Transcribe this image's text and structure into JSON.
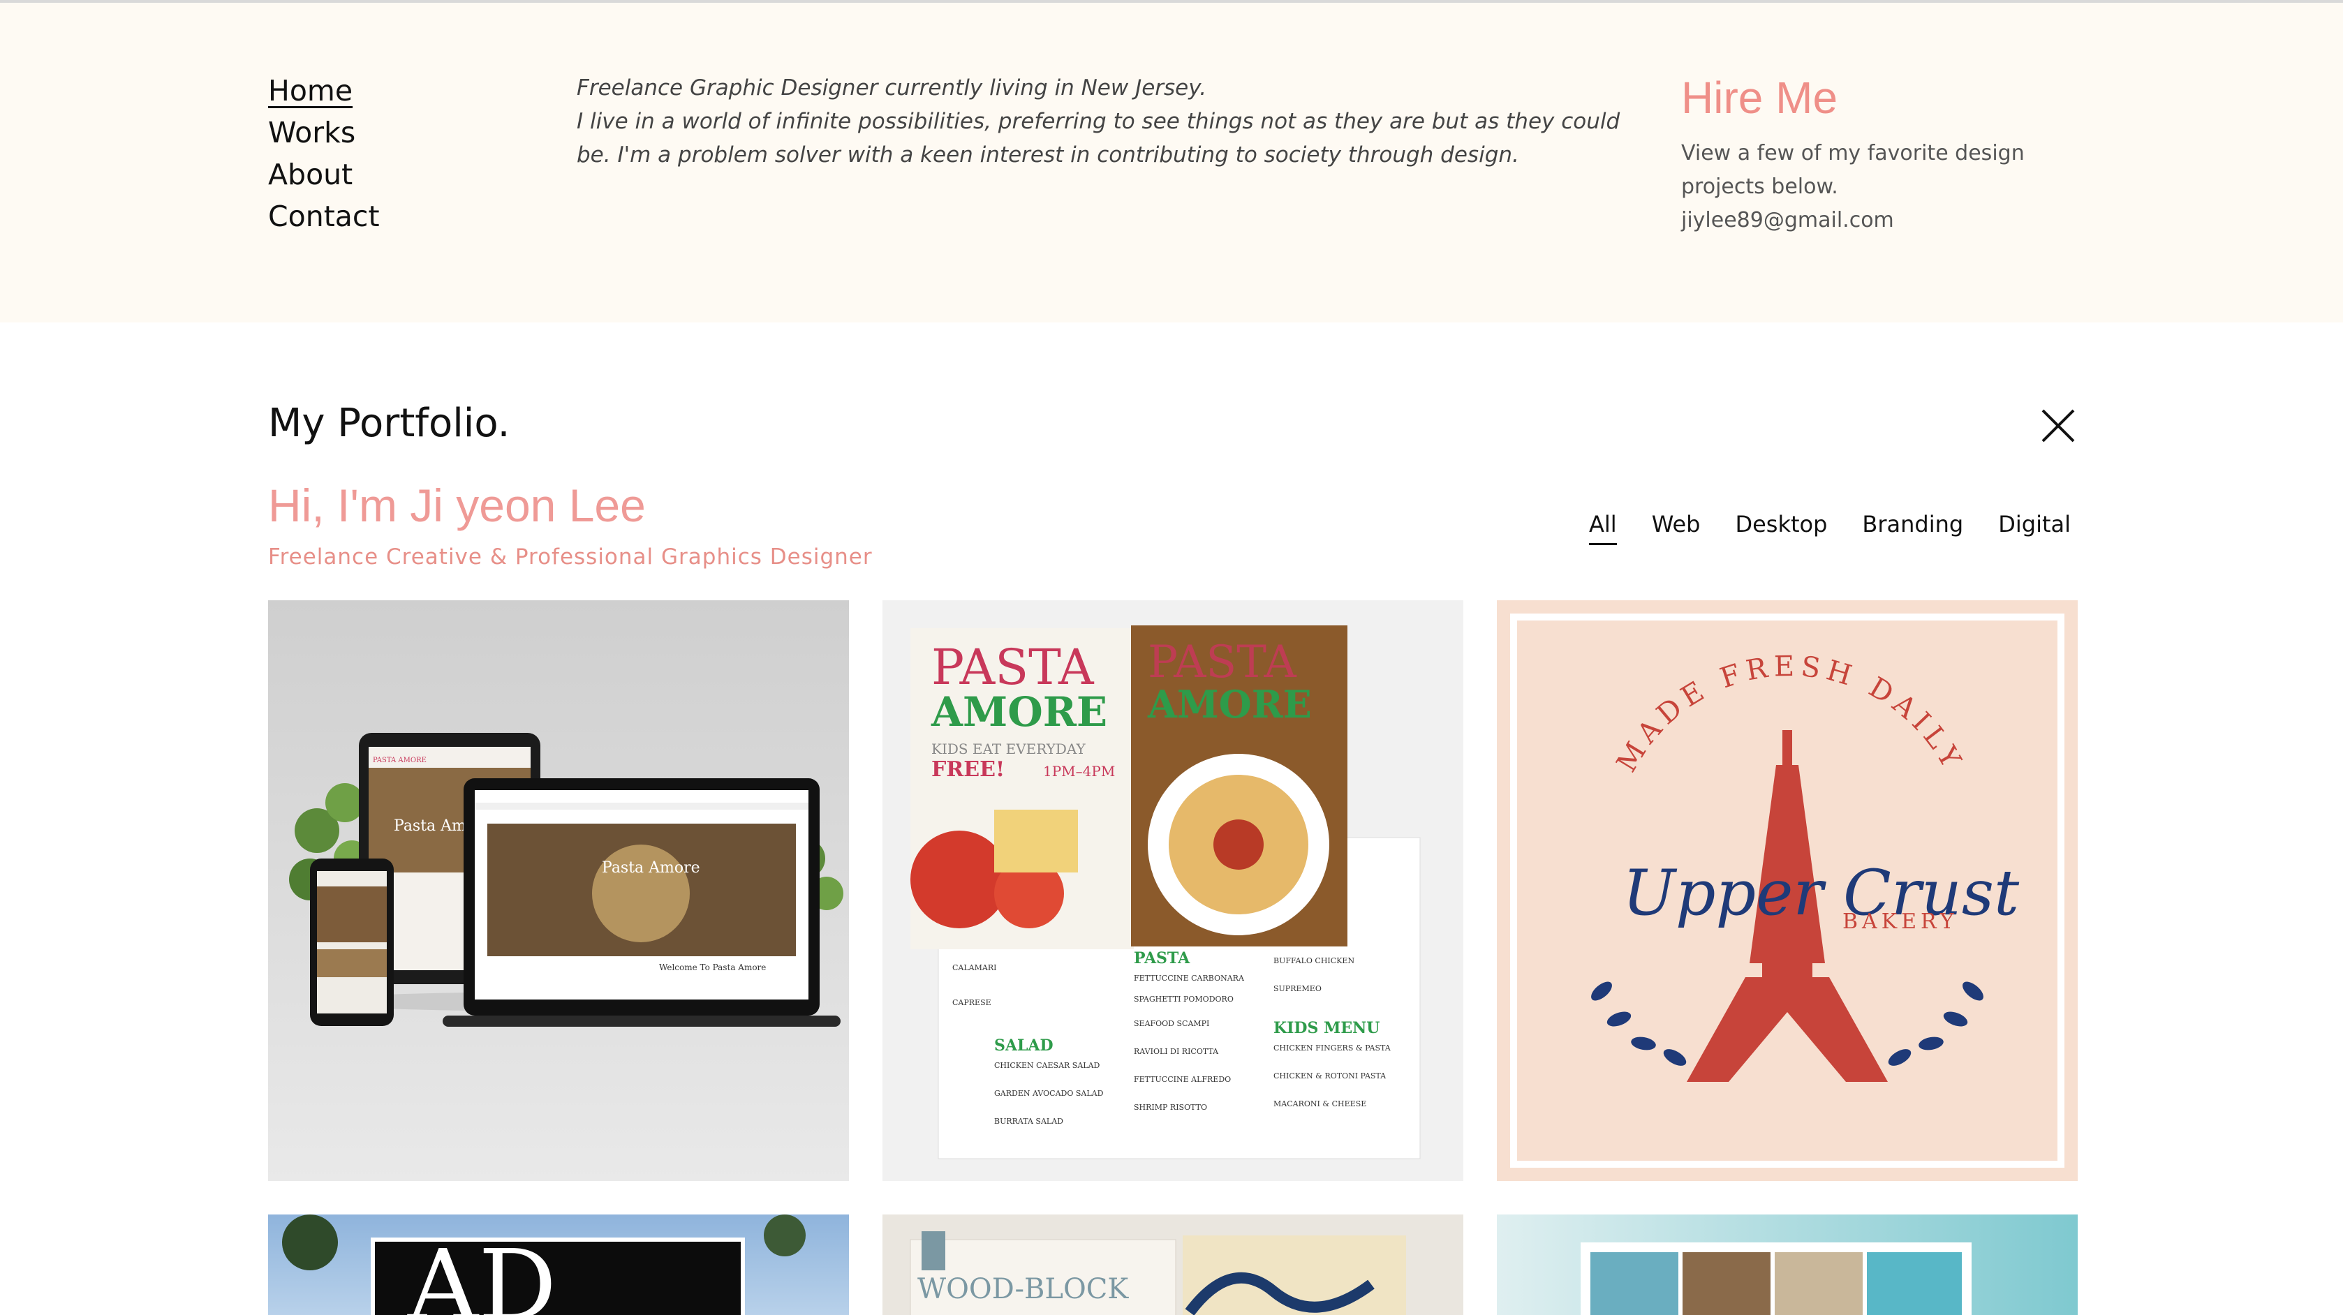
{
  "nav": {
    "items": [
      {
        "label": "Home",
        "active": true
      },
      {
        "label": "Works",
        "active": false
      },
      {
        "label": "About",
        "active": false
      },
      {
        "label": "Contact",
        "active": false
      }
    ]
  },
  "bio": {
    "line1": "Freelance Graphic Designer currently living in New Jersey.",
    "line2": "I live in a world of infinite possibilities, preferring to see things not as they are but as they could be. I'm a problem solver with a keen interest in contributing to society through design."
  },
  "hire": {
    "title": "Hire Me",
    "text": "View a few of my favorite design projects below.",
    "email": "jiylee89@gmail.com"
  },
  "portfolio": {
    "title": "My Portfolio.",
    "greeting": "Hi, I'm Ji yeon Lee",
    "subtitle": "Freelance Creative & Professional Graphics Designer",
    "filters": [
      "All",
      "Web",
      "Desktop",
      "Branding",
      "Digital"
    ],
    "active_filter": "All"
  },
  "tiles": {
    "t1": {
      "brand": "PASTA AMORE",
      "heading": "Pasta Amore",
      "welcome": "Welcome To Pasta Amore"
    },
    "t2": {
      "brand_top": "PASTA",
      "brand_bottom": "AMORE",
      "kids": "KIDS EAT EVERYDAY",
      "free": "FREE!",
      "time": "1PM–4PM",
      "sec_pasta": "PASTA",
      "sec_salad": "SALAD",
      "sec_kids": "KIDS MENU",
      "items": [
        "CALAMARI",
        "CAPRESE",
        "CHICKEN CAESAR SALAD",
        "GARDEN AVOCADO SALAD",
        "BURRATA SALAD",
        "FETTUCCINE CARBONARA",
        "SPAGHETTI POMODORO",
        "SEAFOOD SCAMPI",
        "RAVIOLI DI RICOTTA",
        "FETTUCCINE ALFREDO",
        "SHRIMP RISOTTO",
        "BUFFALO CHICKEN",
        "SUPREMEO",
        "CHICKEN FINGERS & PASTA",
        "CHICKEN & ROTONI PASTA",
        "MACARONI & CHEESE"
      ]
    },
    "t3": {
      "arc": "MADE FRESH DAILY",
      "script": "Upper Crust",
      "bakery": "BAKERY"
    },
    "t4": {
      "letters": "AD"
    },
    "t5": {
      "title": "WOOD-BLOCK"
    }
  },
  "colors": {
    "header_bg": "#fefaf3",
    "accent": "#ef8f88",
    "bakery_red": "#c7443a",
    "bakery_navy": "#1f3a78",
    "pasta_green": "#2e9b4a",
    "pasta_red": "#c8385a"
  }
}
